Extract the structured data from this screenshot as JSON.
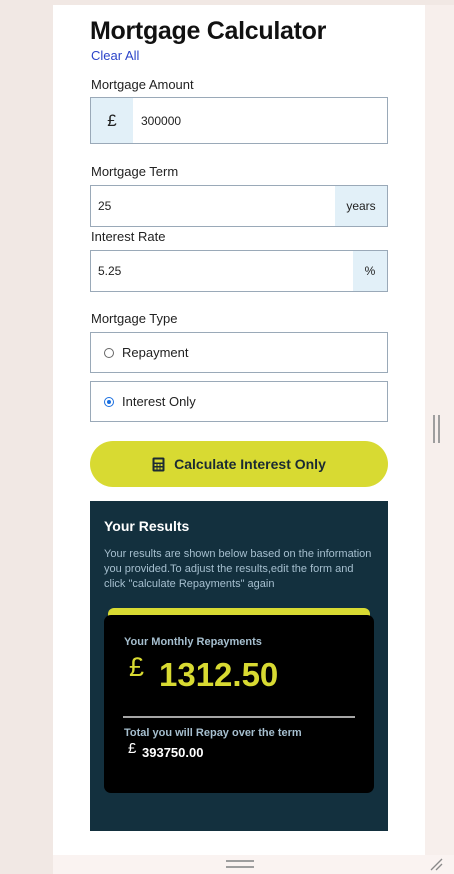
{
  "header": {
    "title": "Mortgage Calculator",
    "clear_label": "Clear All"
  },
  "form": {
    "amount": {
      "label": "Mortgage Amount",
      "prefix": "£",
      "value": "300000"
    },
    "term": {
      "label": "Mortgage Term",
      "value": "25",
      "suffix": "years"
    },
    "rate": {
      "label": "Interest Rate",
      "value": "5.25",
      "suffix": "%"
    },
    "type": {
      "label": "Mortgage Type",
      "options": [
        {
          "label": "Repayment",
          "selected": false
        },
        {
          "label": "Interest Only",
          "selected": true
        }
      ]
    },
    "calculate": {
      "label": "Calculate Interest Only",
      "icon": "calculator-icon"
    }
  },
  "results": {
    "title": "Your Results",
    "description": "Your results are shown below based on the information you provided.To adjust the results,edit the form and click \"calculate Repayments\" again",
    "monthly_label": "Your Monthly Repayments",
    "currency": "£",
    "monthly_value": "1312.50",
    "total_label": "Total you will Repay over the term",
    "total_value": "393750.00"
  },
  "colors": {
    "accent": "#d8da32",
    "results_bg": "#13303e",
    "link": "#2c44c9",
    "addon_bg": "#e2f0f8"
  }
}
